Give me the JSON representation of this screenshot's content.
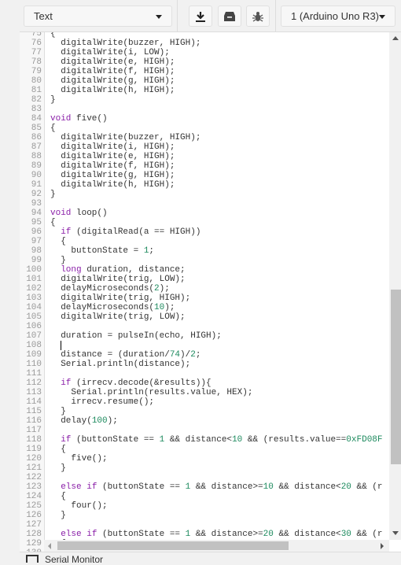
{
  "toolbar": {
    "mode_select": "Text",
    "buttons": [
      {
        "icon": "download-icon"
      },
      {
        "icon": "upload-icon"
      },
      {
        "icon": "bug-icon"
      }
    ],
    "board_select": "1 (Arduino Uno R3)"
  },
  "editor": {
    "first_line": 75,
    "cursor_line": 108,
    "keyword_color": "#8a1fa8",
    "number_color": "#1d8a5e",
    "lines": [
      "{",
      "  digitalWrite(buzzer, HIGH);",
      "  digitalWrite(i, LOW);",
      "  digitalWrite(e, HIGH);",
      "  digitalWrite(f, HIGH);",
      "  digitalWrite(g, HIGH);",
      "  digitalWrite(h, HIGH);",
      "}",
      "",
      "void five()",
      "{",
      "  digitalWrite(buzzer, HIGH);",
      "  digitalWrite(i, HIGH);",
      "  digitalWrite(e, HIGH);",
      "  digitalWrite(f, HIGH);",
      "  digitalWrite(g, HIGH);",
      "  digitalWrite(h, HIGH);",
      "}",
      "",
      "void loop()",
      "{",
      "  if (digitalRead(a == HIGH))",
      "  {",
      "    buttonState = 1;",
      "  }",
      "  long duration, distance;",
      "  digitalWrite(trig, LOW);",
      "  delayMicroseconds(2);",
      "  digitalWrite(trig, HIGH);",
      "  delayMicroseconds(10);",
      "  digitalWrite(trig, LOW);",
      "",
      "  duration = pulseIn(echo, HIGH);",
      "  ",
      "  distance = (duration/74)/2;",
      "  Serial.println(distance);",
      "",
      "  if (irrecv.decode(&results)){",
      "    Serial.println(results.value, HEX);",
      "    irrecv.resume();",
      "  }",
      "  delay(100);",
      "",
      "  if (buttonState == 1 && distance<10 && (results.value==0xFD08F",
      "  {",
      "    five();",
      "  }",
      "",
      "  else if (buttonState == 1 && distance>=10 && distance<20 && (r",
      "  {",
      "    four();",
      "  }",
      "",
      "  else if (buttonState == 1 && distance>=20 && distance<30 && (r",
      "  {",
      ""
    ]
  },
  "bottom_panel": {
    "label": "Serial Monitor"
  }
}
